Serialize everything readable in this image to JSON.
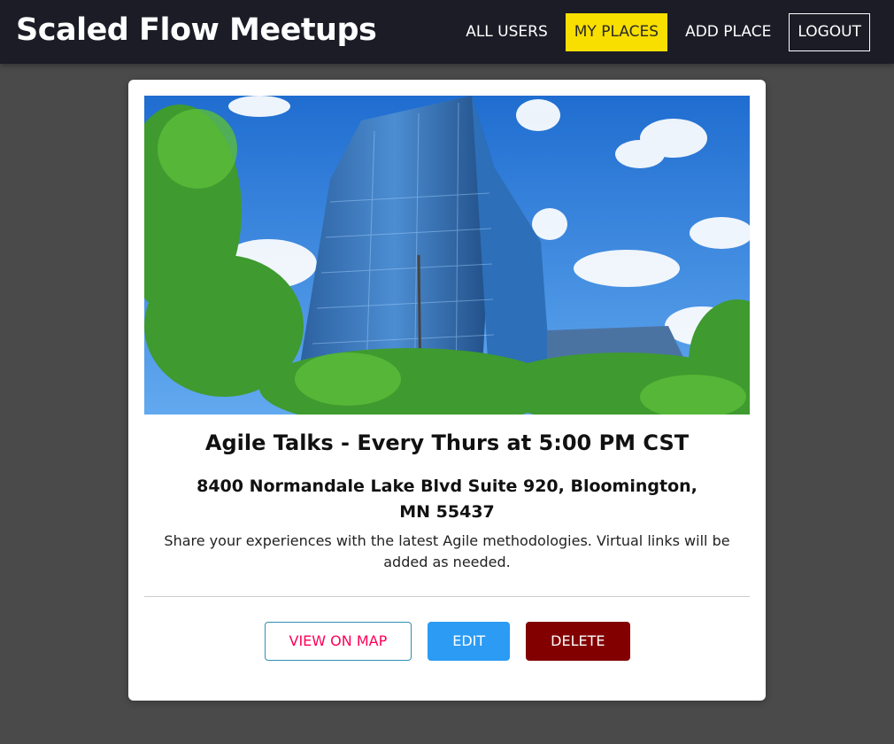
{
  "header": {
    "brand": "Scaled Flow Meetups",
    "nav": [
      {
        "label": "ALL USERS"
      },
      {
        "label": "MY PLACES"
      },
      {
        "label": "ADD PLACE"
      },
      {
        "label": "LOGOUT"
      }
    ],
    "active_color": "#f8df00",
    "background": "#1b1c26"
  },
  "place": {
    "image_subject": "glass-office-tower-photo",
    "title": "Agile Talks - Every Thurs at 5:00 PM CST",
    "address": "8400 Normandale Lake Blvd Suite 920, Bloomington, MN 55437",
    "description": "Share your experiences with the latest Agile methodologies. Virtual links will be added as needed.",
    "actions": {
      "view_on_map": "VIEW ON MAP",
      "edit": "EDIT",
      "delete": "DELETE"
    }
  },
  "colors": {
    "page_background": "#4a4a4a",
    "edit_button": "#2b9bf4",
    "delete_button": "#830000",
    "view_map_text": "#ff0055"
  }
}
